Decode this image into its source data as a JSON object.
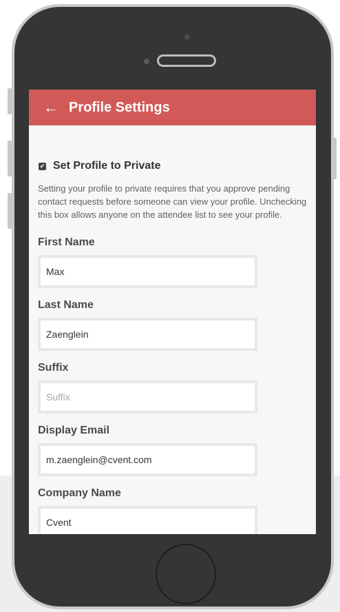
{
  "header": {
    "title": "Profile Settings",
    "back_icon": "←"
  },
  "privacy": {
    "checkbox_checked": true,
    "checkbox_icon": "✔",
    "label": "Set Profile to Private",
    "description": "Setting your profile to private requires that you approve pending contact requests before someone can view your profile. Unchecking this box allows anyone on the attendee list to see your profile."
  },
  "fields": {
    "first_name": {
      "label": "First Name",
      "value": "Max",
      "placeholder": ""
    },
    "last_name": {
      "label": "Last Name",
      "value": "Zaenglein",
      "placeholder": ""
    },
    "suffix": {
      "label": "Suffix",
      "value": "",
      "placeholder": "Suffix"
    },
    "display_email": {
      "label": "Display Email",
      "value": "m.zaenglein@cvent.com",
      "placeholder": ""
    },
    "company_name": {
      "label": "Company Name",
      "value": "Cvent",
      "placeholder": ""
    }
  },
  "colors": {
    "app_bar": "#d15a58",
    "phone_body": "#353535",
    "screen_bg": "#f7f7f7"
  }
}
